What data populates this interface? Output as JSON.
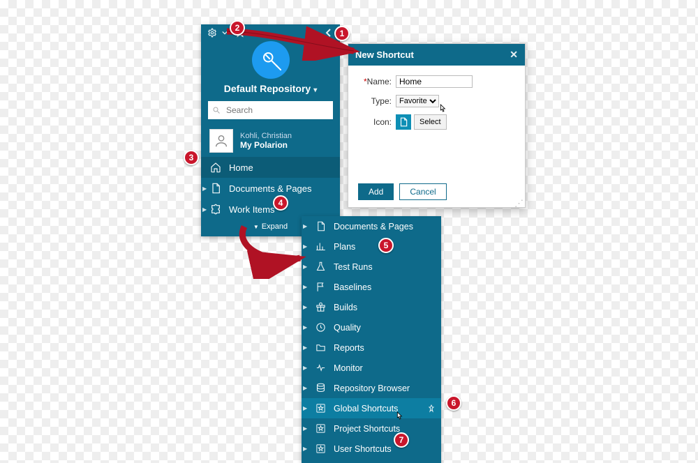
{
  "colors": {
    "brand": "#0e6a8a",
    "badge": "#c9162b"
  },
  "topbar": {
    "gear": "gear-icon",
    "star": "star-icon",
    "collapse": "chevron-left-icon"
  },
  "repository": {
    "title": "Default Repository"
  },
  "search": {
    "placeholder": "Search"
  },
  "user": {
    "name": "Kohli, Christian",
    "scope": "My Polarion"
  },
  "nav": {
    "home": "Home",
    "docs": "Documents & Pages",
    "work_items": "Work Items",
    "expand": "Expand"
  },
  "expanded": {
    "items": [
      {
        "label": "Documents & Pages",
        "icon": "doc-icon"
      },
      {
        "label": "Plans",
        "icon": "chart-icon"
      },
      {
        "label": "Test Runs",
        "icon": "flask-icon"
      },
      {
        "label": "Baselines",
        "icon": "flag-icon"
      },
      {
        "label": "Builds",
        "icon": "gift-icon"
      },
      {
        "label": "Quality",
        "icon": "clock-icon"
      },
      {
        "label": "Reports",
        "icon": "folder-icon"
      },
      {
        "label": "Monitor",
        "icon": "pulse-icon"
      },
      {
        "label": "Repository Browser",
        "icon": "stack-icon"
      },
      {
        "label": "Global Shortcuts",
        "icon": "star-box-icon"
      },
      {
        "label": "Project Shortcuts",
        "icon": "star-box-icon"
      },
      {
        "label": "User Shortcuts",
        "icon": "star-box-icon"
      }
    ]
  },
  "dialog": {
    "title": "New Shortcut",
    "name_label": "Name:",
    "name_value": "Home",
    "type_label": "Type:",
    "type_value": "Favorite",
    "icon_label": "Icon:",
    "select_btn": "Select",
    "add_btn": "Add",
    "cancel_btn": "Cancel"
  },
  "annotations": {
    "1": "1",
    "2": "2",
    "3": "3",
    "4": "4",
    "5": "5",
    "6": "6",
    "7": "7"
  }
}
